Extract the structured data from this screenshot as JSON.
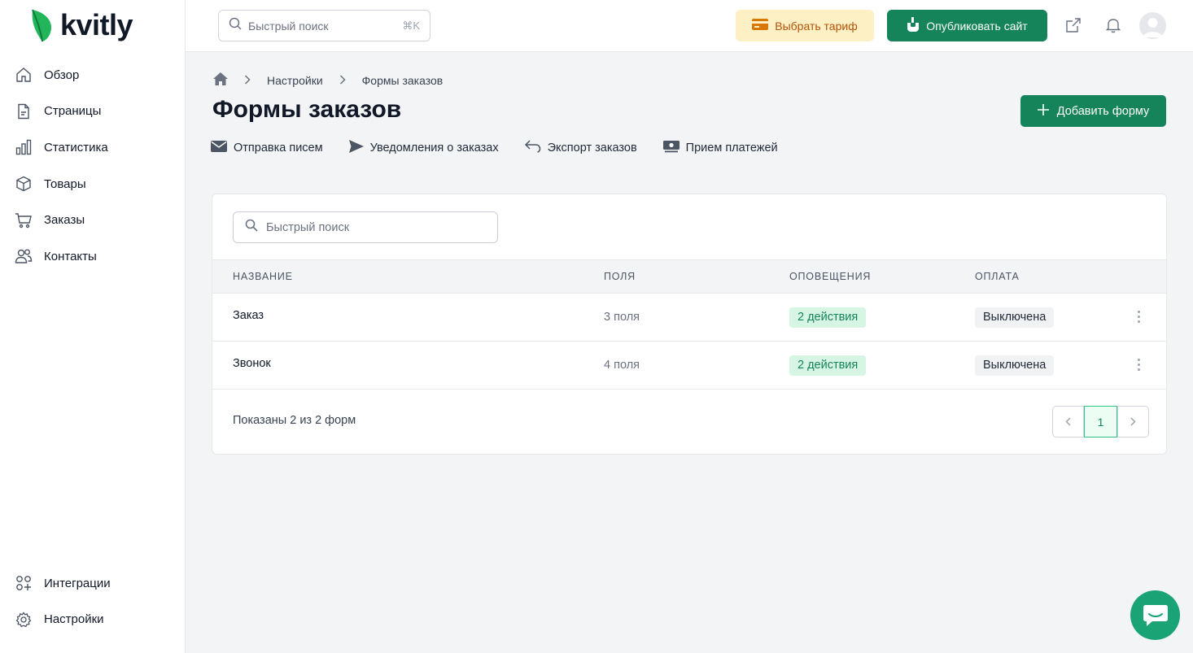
{
  "app": {
    "logo_text": "kvitly",
    "brand_color": "#15845a"
  },
  "sidebar": {
    "items": [
      {
        "label": "Обзор",
        "icon": "home-icon"
      },
      {
        "label": "Страницы",
        "icon": "file-icon"
      },
      {
        "label": "Статистика",
        "icon": "bar-chart-icon"
      },
      {
        "label": "Товары",
        "icon": "box-icon"
      },
      {
        "label": "Заказы",
        "icon": "cart-icon"
      },
      {
        "label": "Контакты",
        "icon": "users-icon"
      }
    ],
    "bottom_items": [
      {
        "label": "Интеграции",
        "icon": "grid-plus-icon"
      },
      {
        "label": "Настройки",
        "icon": "gear-icon"
      }
    ]
  },
  "topbar": {
    "search_placeholder": "Быстрый поиск",
    "search_shortcut": "⌘K",
    "tariff_label": "Выбрать тариф",
    "publish_label": "Опубликовать сайт"
  },
  "breadcrumb": {
    "level1": "Настройки",
    "level2": "Формы заказов"
  },
  "page": {
    "title": "Формы заказов",
    "add_button": "Добавить форму"
  },
  "subnav": {
    "emails": "Отправка писем",
    "notifications": "Уведомления о заказах",
    "export": "Экспорт заказов",
    "payments": "Прием платежей"
  },
  "table": {
    "search_placeholder": "Быстрый поиск",
    "headers": {
      "name": "НАЗВАНИЕ",
      "fields": "ПОЛЯ",
      "notifications": "ОПОВЕЩЕНИЯ",
      "payment": "ОПЛАТА"
    },
    "rows": [
      {
        "name": "Заказ",
        "fields": "3 поля",
        "notifications": "2 действия",
        "payment": "Выключена"
      },
      {
        "name": "Звонок",
        "fields": "4 поля",
        "notifications": "2 действия",
        "payment": "Выключена"
      }
    ],
    "footer": "Показаны 2 из 2 форм",
    "current_page": "1"
  }
}
